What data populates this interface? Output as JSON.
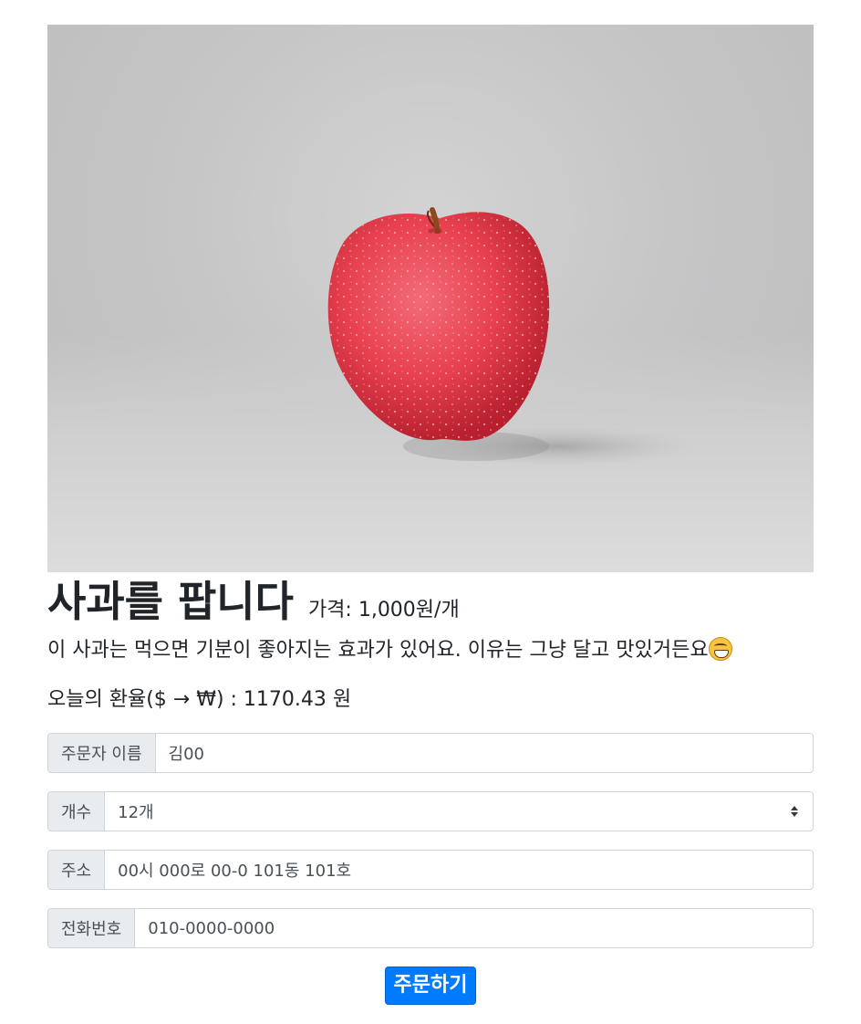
{
  "product": {
    "image_alt": "red-apple-photo",
    "title": "사과를 팝니다",
    "price": "가격: 1,000원/개",
    "description": "이 사과는 먹으면 기분이 좋아지는 효과가 있어요. 이유는 그냥 달고 맛있거든요",
    "emoji": "grinning-face-icon"
  },
  "exchange": {
    "text": "오늘의 환율($ → ₩) : 1170.43 원"
  },
  "form": {
    "name": {
      "label": "주문자 이름",
      "value": "김00"
    },
    "quantity": {
      "label": "개수",
      "value": "12개"
    },
    "address": {
      "label": "주소",
      "value": "00시 000로 00-0 101동 101호"
    },
    "phone": {
      "label": "전화번호",
      "value": "010-0000-0000"
    },
    "submit_label": "주문하기"
  },
  "colors": {
    "primary": "#007bff",
    "apple": "#e8404f"
  }
}
